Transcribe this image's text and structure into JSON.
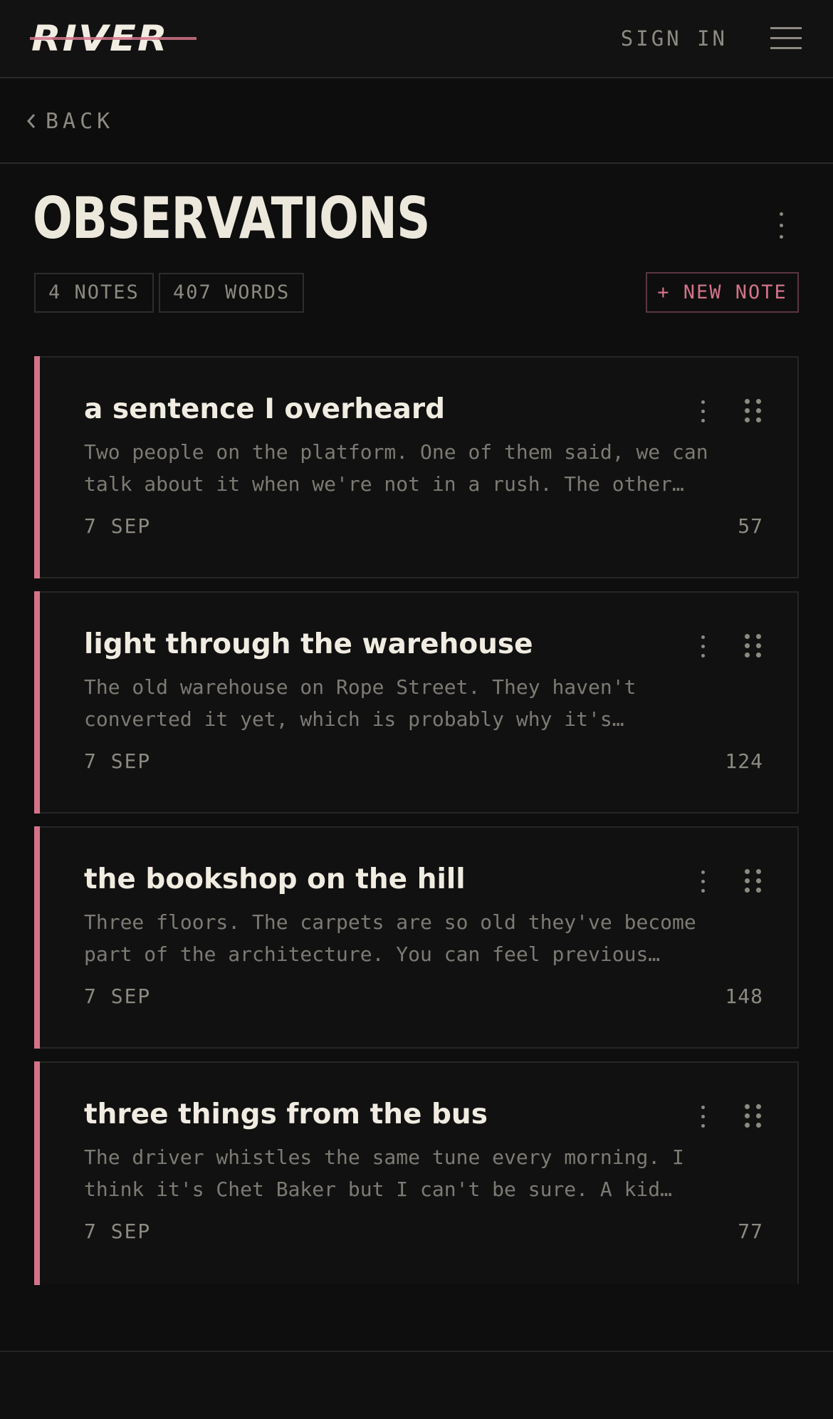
{
  "header": {
    "logo": "RIVER",
    "sign_in": "SIGN IN"
  },
  "nav": {
    "back": "BACK"
  },
  "page": {
    "title": "OBSERVATIONS",
    "notes_count": "4 NOTES",
    "word_count": "407 WORDS",
    "new_note": "+ NEW NOTE"
  },
  "colors": {
    "accent": "#d3738a",
    "background": "#0e0e0e",
    "text": "#ece8dc",
    "muted": "#8d8a82"
  },
  "icons": {
    "back": "chevron-left-icon",
    "menu": "hamburger-icon",
    "more": "vertical-dots-icon",
    "drag": "drag-grip-icon"
  },
  "notes": [
    {
      "title": "a sentence I overheard",
      "excerpt_line1": "Two people on the platform. One of them said, we can",
      "excerpt_line2": "talk about it when we're not in a rush. The other…",
      "date": "7 SEP",
      "words": "57"
    },
    {
      "title": "light through the warehouse",
      "excerpt_line1": "The old warehouse on Rope Street. They haven't",
      "excerpt_line2": "converted it yet, which is probably why it's…",
      "date": "7 SEP",
      "words": "124"
    },
    {
      "title": "the bookshop on the hill",
      "excerpt_line1": "Three floors. The carpets are so old they've become",
      "excerpt_line2": "part of the architecture. You can feel previous…",
      "date": "7 SEP",
      "words": "148"
    },
    {
      "title": "three things from the bus",
      "excerpt_line1": "The driver whistles the same tune every morning. I",
      "excerpt_line2": "think it's Chet Baker but I can't be sure. A kid…",
      "date": "7 SEP",
      "words": "77"
    }
  ]
}
